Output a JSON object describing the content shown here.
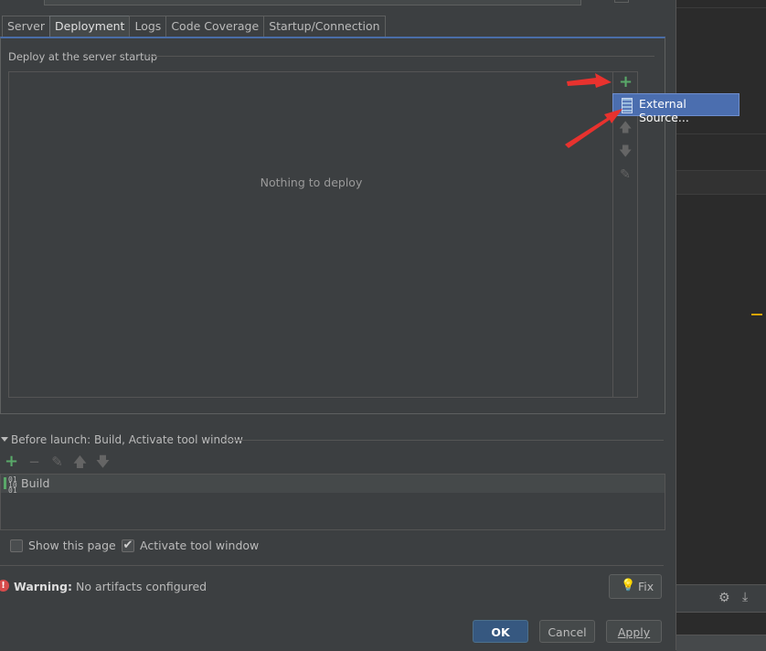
{
  "tabs": [
    {
      "label": "Server",
      "active": false
    },
    {
      "label": "Deployment",
      "active": true
    },
    {
      "label": "Logs",
      "active": false
    },
    {
      "label": "Code Coverage",
      "active": false
    },
    {
      "label": "Startup/Connection",
      "active": false
    }
  ],
  "deploy": {
    "section_label": "Deploy at the server startup",
    "empty_text": "Nothing to deploy",
    "toolbar": {
      "add_icon": "plus-icon",
      "up_icon": "arrow-up-icon",
      "down_icon": "arrow-down-icon",
      "edit_icon": "pencil-icon"
    },
    "popup": {
      "item_label": "External Source...",
      "item_icon": "external-source-icon"
    }
  },
  "before_launch": {
    "title": "Before launch: Build, Activate tool window",
    "tools": [
      "plus-icon",
      "minus-icon",
      "pencil-icon",
      "arrow-up-icon",
      "arrow-down-icon"
    ],
    "items": [
      {
        "label": "Build",
        "icon": "build-icon"
      }
    ]
  },
  "options": {
    "show_page": {
      "label": "Show this page",
      "checked": false
    },
    "activate_tool_window": {
      "label": "Activate tool window",
      "checked": true
    }
  },
  "warning": {
    "label": "Warning:",
    "text": "No artifacts configured",
    "fix_label": "Fix"
  },
  "buttons": {
    "ok": "OK",
    "cancel": "Cancel",
    "apply": "Apply"
  },
  "colors": {
    "background": "#3c3f41",
    "accent_blue": "#4b6eaf",
    "add_green": "#59a869",
    "annotation_red": "#e8322e",
    "error_red": "#d64b4b"
  }
}
